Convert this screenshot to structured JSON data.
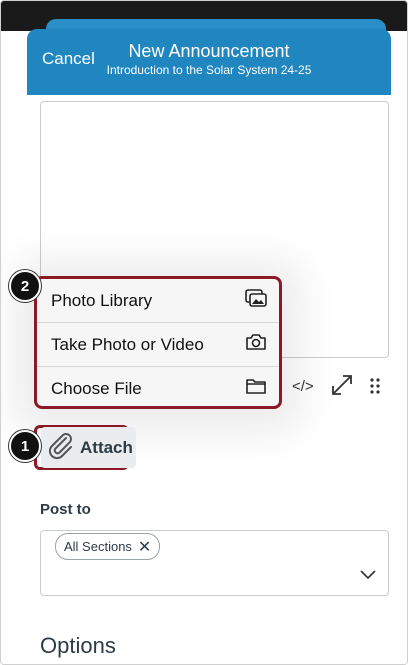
{
  "header": {
    "cancel_label": "Cancel",
    "title": "New Announcement",
    "subtitle": "Introduction to the Solar System  24-25",
    "color": "#2086c0"
  },
  "editor": {
    "toolbar": {
      "html_label": "</>",
      "expand_icon": "expand-icon",
      "more_icon": "more-vertical-icon"
    }
  },
  "attach_menu": {
    "items": [
      {
        "label": "Photo Library",
        "icon": "photo-library-icon"
      },
      {
        "label": "Take Photo or Video",
        "icon": "camera-icon"
      },
      {
        "label": "Choose File",
        "icon": "folder-icon"
      }
    ]
  },
  "attach": {
    "label": "Attach",
    "icon": "paperclip-icon"
  },
  "callouts": {
    "one": "1",
    "two": "2",
    "color": "#8b1a26"
  },
  "post_to": {
    "label": "Post to",
    "selected": "All Sections",
    "remove_glyph": "✕"
  },
  "options": {
    "label": "Options"
  }
}
